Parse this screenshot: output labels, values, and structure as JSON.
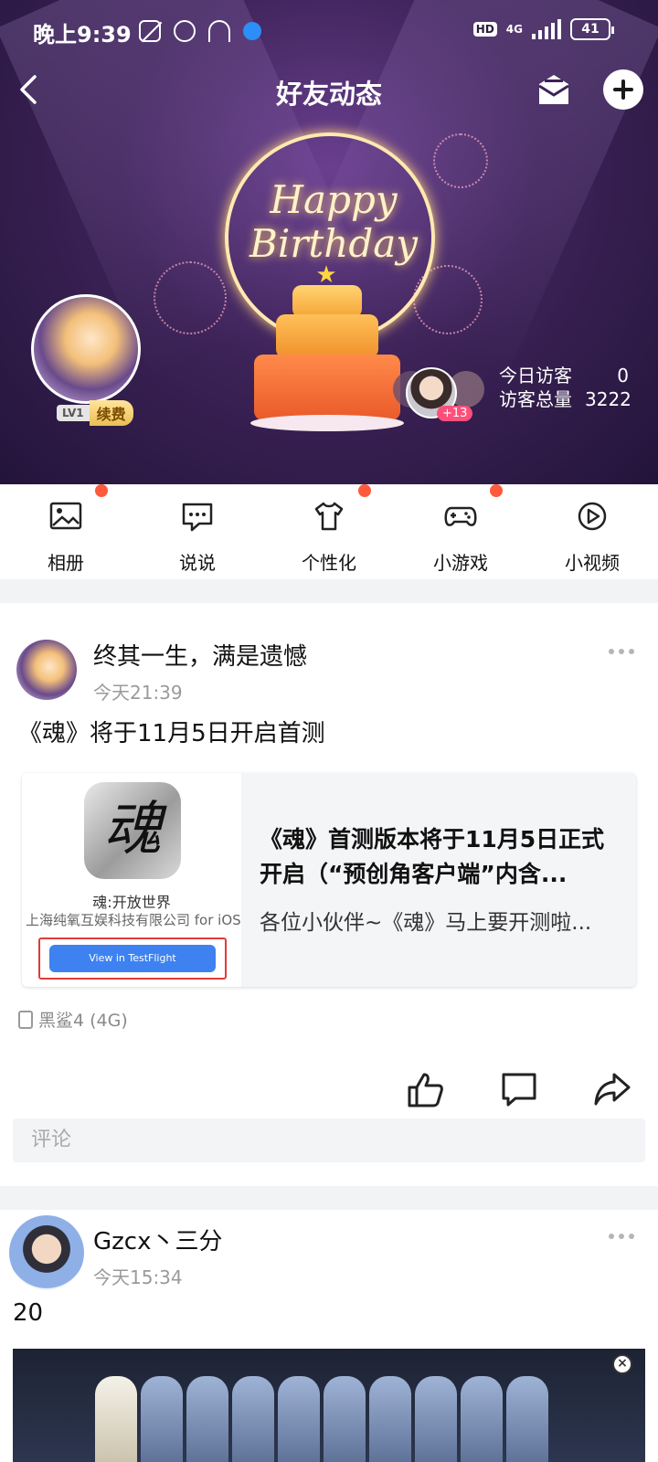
{
  "status_bar": {
    "time": "晚上9:39",
    "network": "4G",
    "hd": "HD",
    "battery": "41"
  },
  "nav": {
    "title": "好友动态"
  },
  "banner": {
    "greeting": "Happy Birthday",
    "level": "LV1",
    "renew_label": "续费",
    "visitor_more": "+13",
    "today_visitors_label": "今日访客",
    "today_visitors_value": "0",
    "total_visitors_label": "访客总量",
    "total_visitors_value": "3222"
  },
  "quick_nav": [
    {
      "label": "相册",
      "icon": "album-icon",
      "badge": true
    },
    {
      "label": "说说",
      "icon": "chat-bubble-icon",
      "badge": false
    },
    {
      "label": "个性化",
      "icon": "shirt-icon",
      "badge": true
    },
    {
      "label": "小游戏",
      "icon": "gamepad-icon",
      "badge": true
    },
    {
      "label": "小视频",
      "icon": "play-icon",
      "badge": false
    }
  ],
  "posts": [
    {
      "author": "终其一生，满是遗憾",
      "time": "今天21:39",
      "text": "《魂》将于11月5日开启首测",
      "link_card": {
        "app_icon_char": "魂",
        "app_name": "魂:开放世界",
        "app_developer": "上海纯氧互娱科技有限公司 for iOS",
        "testflight_button": "View in TestFlight",
        "title": "《魂》首测版本将于11月5日正式开启（“预创角客户端”内含...",
        "description": "各位小伙伴~《魂》马上要开测啦..."
      },
      "device": "黑鲨4 (4G)",
      "comment_placeholder": "评论"
    },
    {
      "author": "Gzcx丶三分",
      "time": "今天15:34",
      "text": "20"
    }
  ],
  "colors": {
    "accent_red": "#ff5a3c",
    "banner_purple": "#3d2358",
    "testflight_blue": "#3d82f0"
  }
}
